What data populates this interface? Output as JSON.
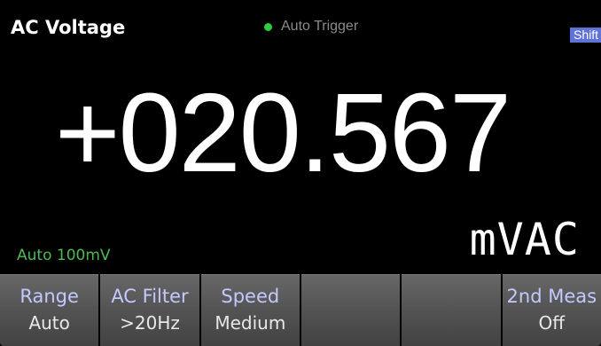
{
  "header": {
    "title": "AC Voltage",
    "trigger_label": "Auto Trigger",
    "trigger_color": "#2ecc40",
    "shift_label": "Shift",
    "shift_color": "#5f73d6"
  },
  "measurement": {
    "reading": "+020.567",
    "unit": "mVAC",
    "range_info": "Auto 100mV",
    "range_info_color": "#4dbb55"
  },
  "softkeys": [
    {
      "label": "Range",
      "value": "Auto"
    },
    {
      "label": "AC Filter",
      "value": ">20Hz"
    },
    {
      "label": "Speed",
      "value": "Medium"
    },
    {
      "label": "",
      "value": ""
    },
    {
      "label": "",
      "value": ""
    },
    {
      "label": "2nd Meas",
      "value": "Off"
    }
  ]
}
